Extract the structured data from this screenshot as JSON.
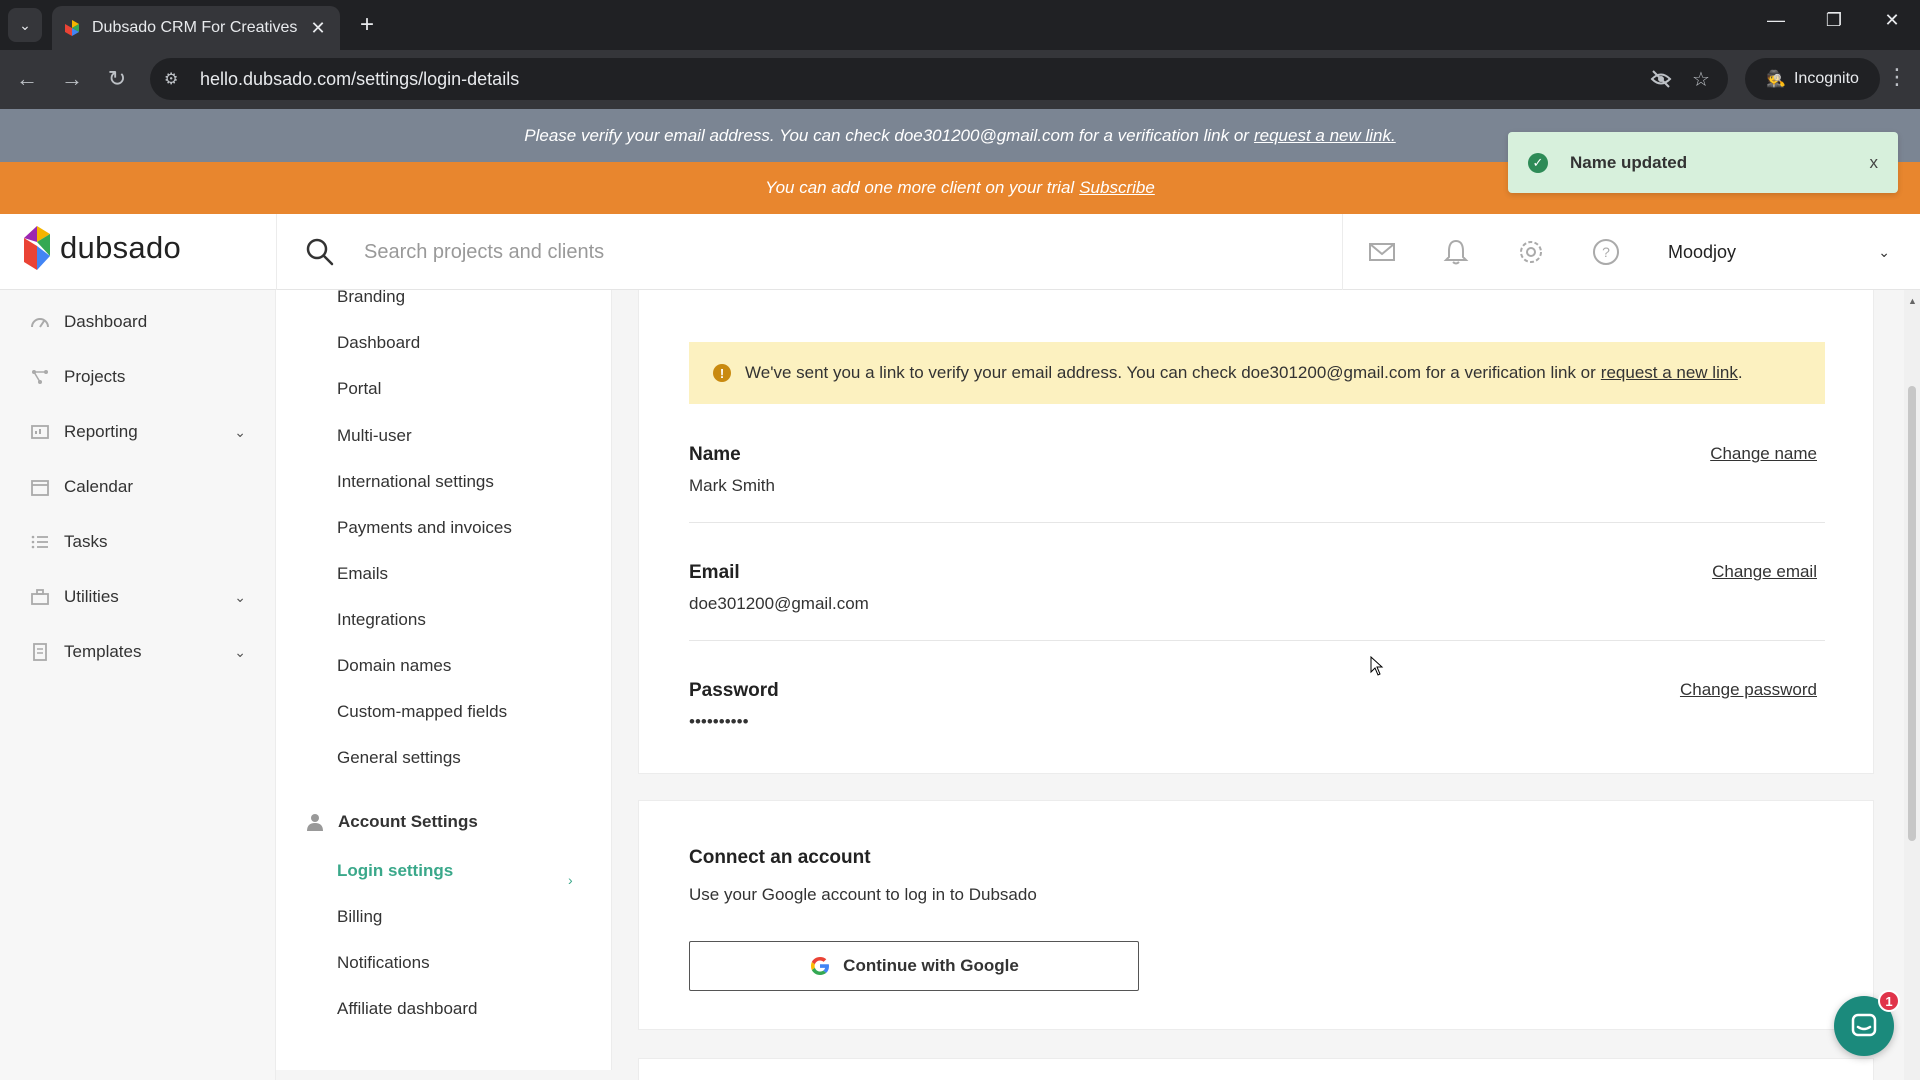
{
  "browser": {
    "tab_title": "Dubsado CRM For Creatives",
    "url": "hello.dubsado.com/settings/login-details",
    "incognito_label": "Incognito"
  },
  "banners": {
    "verify_text": "Please verify your email address. You can check doe301200@gmail.com for a verification link or",
    "verify_link": "request a new link.",
    "trial_text": "You can add one more client on your trial",
    "trial_link": "Subscribe"
  },
  "toast": {
    "message": "Name updated",
    "close": "x"
  },
  "header": {
    "brand": "dubsado",
    "search_placeholder": "Search projects and clients",
    "user_name": "Moodjoy"
  },
  "leftnav": {
    "items": [
      {
        "label": "Dashboard",
        "icon": "dashboard-icon"
      },
      {
        "label": "Projects",
        "icon": "projects-icon"
      },
      {
        "label": "Reporting",
        "icon": "reporting-icon"
      },
      {
        "label": "Calendar",
        "icon": "calendar-icon"
      },
      {
        "label": "Tasks",
        "icon": "tasks-icon"
      },
      {
        "label": "Utilities",
        "icon": "utilities-icon"
      },
      {
        "label": "Templates",
        "icon": "templates-icon"
      }
    ]
  },
  "settings_nav": {
    "items": [
      "Branding",
      "Dashboard",
      "Portal",
      "Multi-user",
      "International settings",
      "Payments and invoices",
      "Emails",
      "Integrations",
      "Domain names",
      "Custom-mapped fields",
      "General settings"
    ],
    "account_header": "Account Settings",
    "account_items": [
      "Login settings",
      "Billing",
      "Notifications",
      "Affiliate dashboard"
    ]
  },
  "main": {
    "alert_text": "We've sent you a link to verify your email address. You can check doe301200@gmail.com for a verification link or",
    "alert_link": "request a new link",
    "alert_end": ".",
    "name_label": "Name",
    "name_value": "Mark Smith",
    "name_action": "Change name",
    "email_label": "Email",
    "email_value": "doe301200@gmail.com",
    "email_action": "Change email",
    "password_label": "Password",
    "password_value": "••••••••••",
    "password_action": "Change password",
    "connect_title": "Connect an account",
    "connect_desc": "Use your Google account to log in to Dubsado",
    "google_button": "Continue with Google"
  },
  "chat": {
    "badge": "1"
  },
  "colors": {
    "trial_banner": "#e8862e",
    "verify_banner": "#7b8593",
    "accent_green": "#3aa88a",
    "alert_bg": "#fcf1c0",
    "toast_bg": "#d7f0dc"
  }
}
